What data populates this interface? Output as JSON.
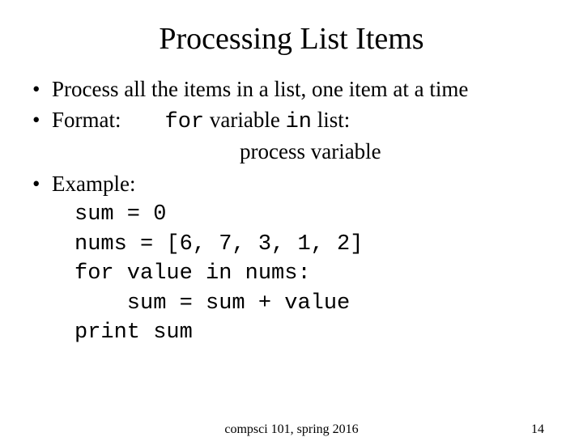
{
  "title": "Processing List Items",
  "bullets": {
    "b1": "Process all the items in a list, one item at a time",
    "b2_label": "Format:",
    "b2_for": "for",
    "b2_mid": " variable ",
    "b2_in": "in",
    "b2_tail": " list:",
    "b2_line2": "process variable",
    "b3_label": "Example:"
  },
  "code": {
    "l1": "sum = 0",
    "l2": "nums = [6, 7, 3, 1, 2]",
    "l3": "for value in nums:",
    "l4": "    sum = sum + value",
    "l5": "print sum"
  },
  "footer": {
    "center": "compsci 101, spring 2016",
    "page": "14"
  }
}
